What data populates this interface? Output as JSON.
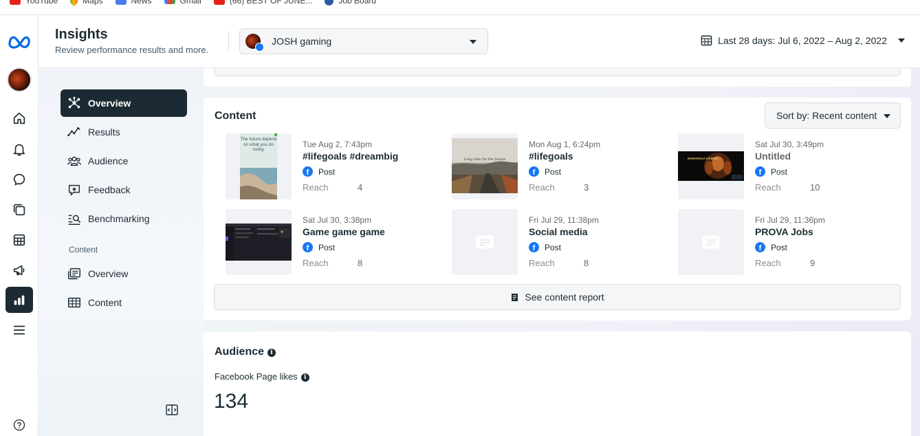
{
  "bookmarks": [
    {
      "label": "YouTube",
      "icon": "youtube-icon"
    },
    {
      "label": "Maps",
      "icon": "maps-icon"
    },
    {
      "label": "News",
      "icon": "news-icon"
    },
    {
      "label": "Gmail",
      "icon": "gmail-icon"
    },
    {
      "label": "(66) BEST OF JUNE...",
      "icon": "youtube-icon"
    },
    {
      "label": "Job Board",
      "icon": "globe-icon"
    }
  ],
  "header": {
    "title": "Insights",
    "subtitle": "Review performance results and more.",
    "page_selector": "JOSH gaming",
    "date_range": "Last 28 days: Jul 6, 2022 – Aug 2, 2022"
  },
  "sidebar": {
    "items": [
      {
        "label": "Overview",
        "icon": "overview-icon"
      },
      {
        "label": "Results",
        "icon": "results-icon"
      },
      {
        "label": "Audience",
        "icon": "audience-icon"
      },
      {
        "label": "Feedback",
        "icon": "feedback-icon"
      },
      {
        "label": "Benchmarking",
        "icon": "benchmarking-icon"
      }
    ],
    "section_label": "Content",
    "content_items": [
      {
        "label": "Overview",
        "icon": "content-overview-icon"
      },
      {
        "label": "Content",
        "icon": "content-table-icon"
      }
    ]
  },
  "content_card": {
    "title": "Content",
    "sort_label": "Sort by: Recent content",
    "reach_label": "Reach",
    "posts": [
      {
        "date": "Tue Aug 2, 7:43pm",
        "title": "#lifegoals #dreambig",
        "type": "Post",
        "reach": "4"
      },
      {
        "date": "Mon Aug 1, 6:24pm",
        "title": "#lifegoals",
        "type": "Post",
        "reach": "3"
      },
      {
        "date": "Sat Jul 30, 3:49pm",
        "title": "Untitled",
        "type": "Post",
        "reach": "10"
      },
      {
        "date": "Sat Jul 30, 3:38pm",
        "title": "Game game game",
        "type": "Post",
        "reach": "8"
      },
      {
        "date": "Fri Jul 29, 11:38pm",
        "title": "Social media",
        "type": "Post",
        "reach": "8"
      },
      {
        "date": "Fri Jul 29, 11:36pm",
        "title": "PROVA Jobs",
        "type": "Post",
        "reach": "9"
      }
    ],
    "thumb1_text": "The future depend on what you do today",
    "thumb2_text": "Long ride for the future",
    "thumb3_text": "MAHAPAKA GAMING",
    "see_report_label": "See content report"
  },
  "audience_card": {
    "title": "Audience",
    "subtitle": "Facebook Page likes",
    "value": "134"
  },
  "colors": {
    "nav_active": "#1c2b33",
    "facebook_blue": "#1877f2",
    "meta_blue": "#0668e1"
  }
}
